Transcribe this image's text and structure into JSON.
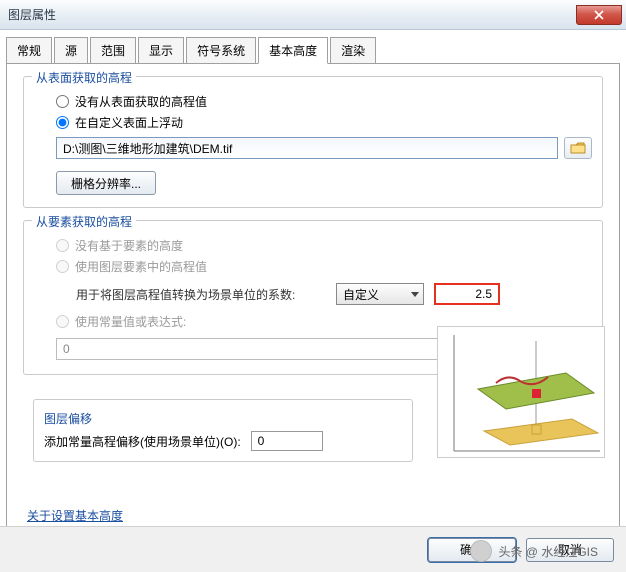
{
  "window": {
    "title": "图层属性"
  },
  "tabs": [
    "常规",
    "源",
    "范围",
    "显示",
    "符号系统",
    "基本高度",
    "渲染"
  ],
  "active_tab": 5,
  "g1": {
    "title": "从表面获取的高程",
    "opt1": "没有从表面获取的高程值",
    "opt2": "在自定义表面上浮动",
    "path": "D:\\测图\\三维地形加建筑\\DEM.tif",
    "res_btn": "栅格分辨率..."
  },
  "g2": {
    "title": "从要素获取的高程",
    "opt1": "没有基于要素的高度",
    "opt2": "使用图层要素中的高程值",
    "factor_label": "用于将图层高程值转换为场景单位的系数:",
    "dropdown": "自定义",
    "factor": "2.5",
    "opt3": "使用常量值或表达式:",
    "const_val": "0"
  },
  "g3": {
    "title": "图层偏移",
    "label": "添加常量高程偏移(使用场景单位)(O):",
    "value": "0"
  },
  "link": "关于设置基本高度",
  "footer": {
    "ok": "确定",
    "cancel": "取消"
  },
  "watermark": "头条 @ 水经注GIS"
}
